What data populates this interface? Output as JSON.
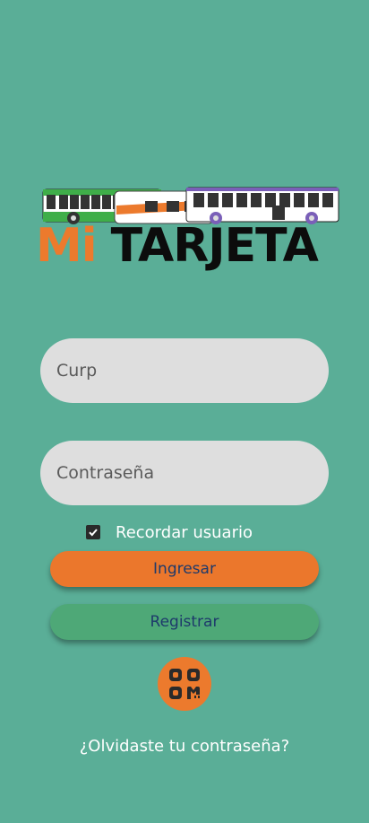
{
  "logo": {
    "text_mi": "Mi",
    "text_tarjeta": "TARJETA"
  },
  "form": {
    "curp_placeholder": "Curp",
    "password_placeholder": "Contraseña",
    "remember_label": "Recordar usuario",
    "remember_checked": true
  },
  "buttons": {
    "login_label": "Ingresar",
    "register_label": "Registrar"
  },
  "qr_button": {
    "icon": "qr-code-icon"
  },
  "links": {
    "forgot_password": "¿Olvidaste tu contraseña?"
  },
  "colors": {
    "background": "#5aae97",
    "accent_orange": "#eb772c",
    "register_green": "#4ea877",
    "button_text": "#1e3a6b"
  }
}
